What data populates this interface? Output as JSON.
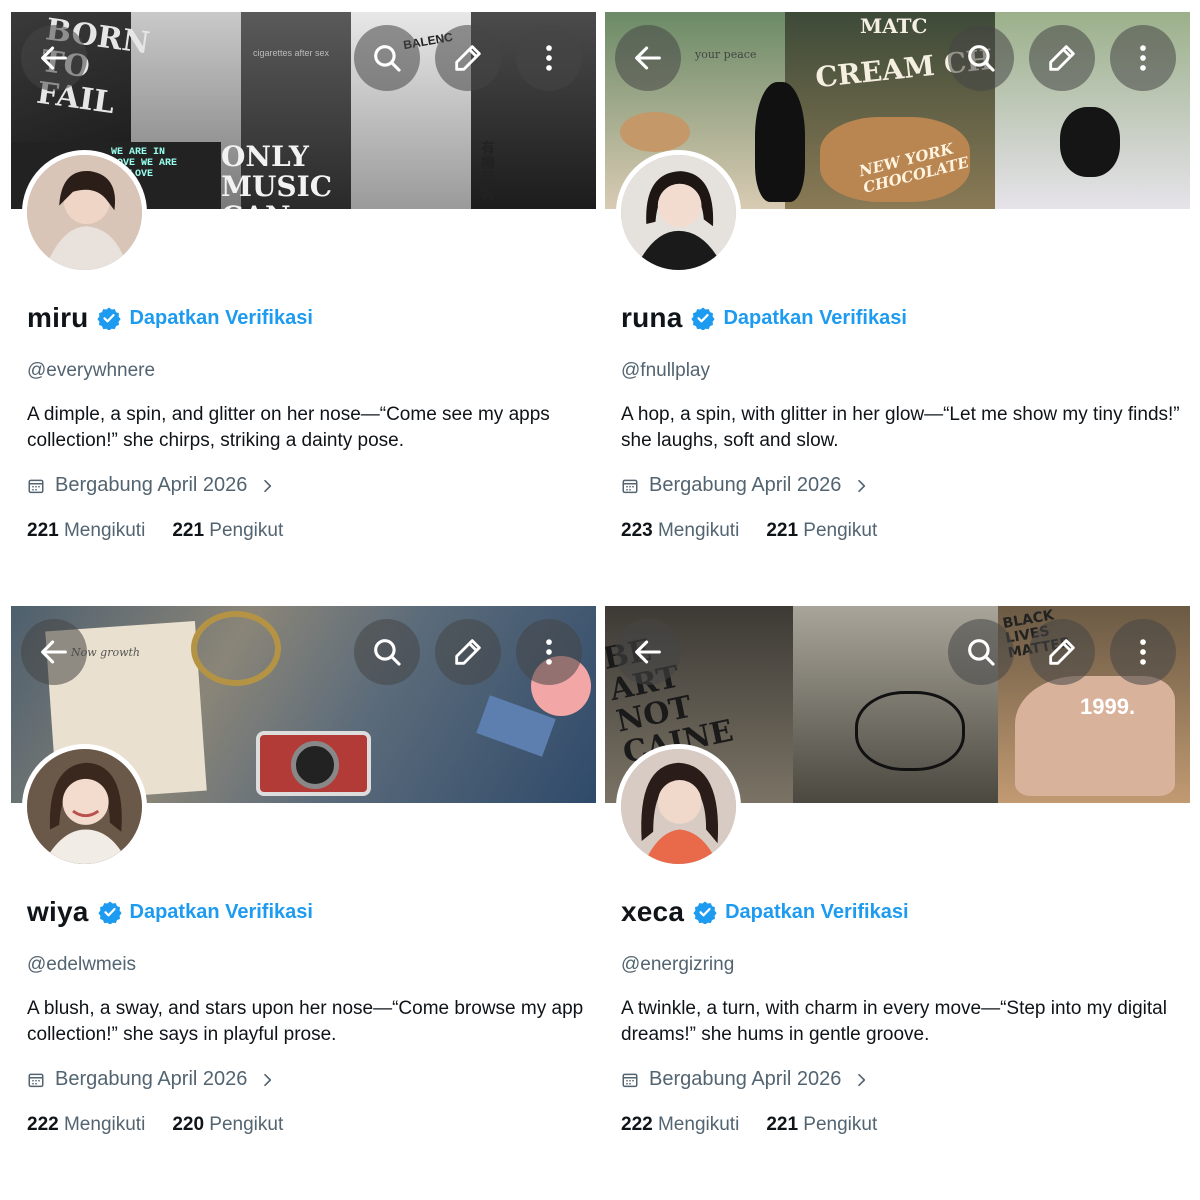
{
  "cards": [
    {
      "display_name": "miru",
      "verify_label": "Dapatkan Verifikasi",
      "handle": "@everywhnere",
      "bio": "A dimple, a spin, and glitter on her nose—“Come see my apps collection!” she chirps, striking a dainty pose.",
      "joined": "Bergabung April 2026",
      "following_count": "221",
      "following_label": "Mengikuti",
      "followers_count": "221",
      "followers_label": "Pengikut",
      "banner_texts": {
        "a": "BORN TO FAIL",
        "b": "ONLY MUSIC CAN SAVE",
        "c": "BALENC",
        "d": "cigarettes after sex",
        "e": "WE ARE IN LOVE WE ARE IN LOVE",
        "f": "有機豆乳"
      }
    },
    {
      "display_name": "runa",
      "verify_label": "Dapatkan Verifikasi",
      "handle": "@fnullplay",
      "bio": "A hop, a spin, with glitter in her glow—“Let me show my tiny finds!” she laughs, soft and slow.",
      "joined": "Bergabung April 2026",
      "following_count": "223",
      "following_label": "Mengikuti",
      "followers_count": "221",
      "followers_label": "Pengikut",
      "banner_texts": {
        "a": "your peace",
        "b": "CREAM CH",
        "c": "NEW YORK CHOCOLATE",
        "d": "MATC"
      }
    },
    {
      "display_name": "wiya",
      "verify_label": "Dapatkan Verifikasi",
      "handle": "@edelwmeis",
      "bio": "A blush, a sway, and stars upon her nose—“Come browse my app collection!” she says in playful prose.",
      "joined": "Bergabung April 2026",
      "following_count": "222",
      "following_label": "Mengikuti",
      "followers_count": "220",
      "followers_label": "Pengikut",
      "banner_texts": {
        "a": "Now growth"
      }
    },
    {
      "display_name": "xeca",
      "verify_label": "Dapatkan Verifikasi",
      "handle": "@energizring",
      "bio": "A twinkle, a turn, with charm in every move—“Step into my digital dreams!” she hums in gentle groove.",
      "joined": "Bergabung April 2026",
      "following_count": "222",
      "following_label": "Mengikuti",
      "followers_count": "221",
      "followers_label": "Pengikut",
      "banner_texts": {
        "a": "BE ART NOT CAINE",
        "b": "BLACK LIVES MATTER",
        "c": "1999."
      }
    }
  ],
  "icons": {
    "back": "arrow-left-icon",
    "search": "search-icon",
    "edit": "pencil-icon",
    "more": "more-vertical-icon",
    "verified": "verified-badge-icon",
    "calendar": "calendar-icon",
    "chevron": "chevron-right-icon"
  },
  "colors": {
    "accent": "#1d9bf0",
    "text_primary": "#0f1419",
    "text_secondary": "#536471"
  }
}
